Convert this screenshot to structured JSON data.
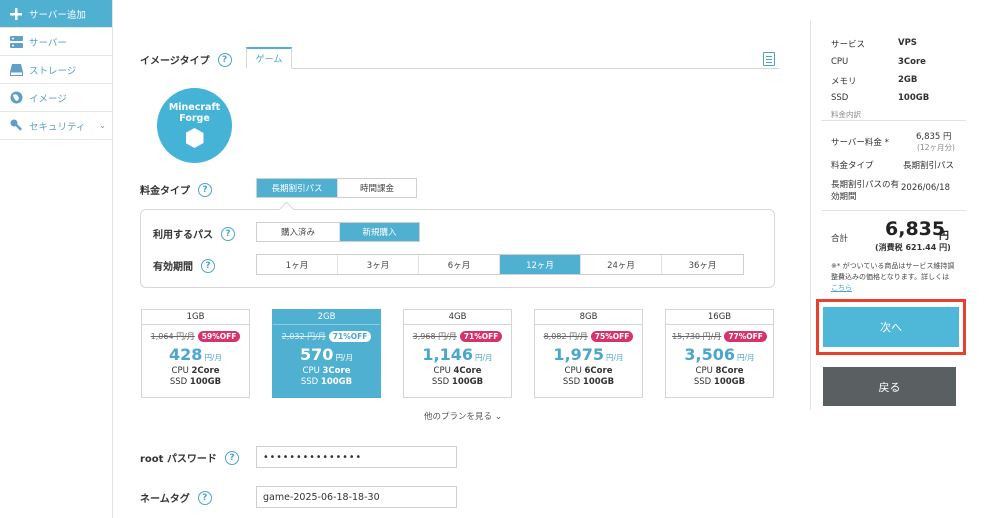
{
  "sidebar": {
    "items": [
      {
        "label": "サーバー追加",
        "icon": "plus-icon"
      },
      {
        "label": "サーバー",
        "icon": "server-icon"
      },
      {
        "label": "ストレージ",
        "icon": "storage-icon"
      },
      {
        "label": "イメージ",
        "icon": "image-icon"
      },
      {
        "label": "セキュリティ",
        "icon": "key-icon"
      }
    ]
  },
  "image_type": {
    "label": "イメージタイプ",
    "tab": "ゲーム",
    "logo_line1": "Minecraft",
    "logo_line2": "Forge"
  },
  "pricing": {
    "label": "料金タイプ",
    "options": [
      "長期割引パス",
      "時間課金"
    ],
    "selected": "長期割引パス",
    "pass_label": "利用するパス",
    "pass_options": [
      "購入済み",
      "新規購入"
    ],
    "pass_selected": "新規購入",
    "period_label": "有効期間",
    "periods": [
      "1ヶ月",
      "3ヶ月",
      "6ヶ月",
      "12ヶ月",
      "24ヶ月",
      "36ヶ月"
    ],
    "period_selected": "12ヶ月"
  },
  "plans": [
    {
      "memory": "1GB",
      "orig": "1,064 円/月",
      "discount": "59%OFF",
      "price": "428",
      "unit": "円/月",
      "cpu_label": "CPU",
      "cpu": "2Core",
      "ssd_label": "SSD",
      "ssd": "100GB"
    },
    {
      "memory": "2GB",
      "orig": "2,032 円/月",
      "discount": "71%OFF",
      "price": "570",
      "unit": "円/月",
      "cpu_label": "CPU",
      "cpu": "3Core",
      "ssd_label": "SSD",
      "ssd": "100GB"
    },
    {
      "memory": "4GB",
      "orig": "3,968 円/月",
      "discount": "71%OFF",
      "price": "1,146",
      "unit": "円/月",
      "cpu_label": "CPU",
      "cpu": "4Core",
      "ssd_label": "SSD",
      "ssd": "100GB"
    },
    {
      "memory": "8GB",
      "orig": "8,082 円/月",
      "discount": "75%OFF",
      "price": "1,975",
      "unit": "円/月",
      "cpu_label": "CPU",
      "cpu": "6Core",
      "ssd_label": "SSD",
      "ssd": "100GB"
    },
    {
      "memory": "16GB",
      "orig": "15,730 円/月",
      "discount": "77%OFF",
      "price": "3,506",
      "unit": "円/月",
      "cpu_label": "CPU",
      "cpu": "8Core",
      "ssd_label": "SSD",
      "ssd": "100GB"
    }
  ],
  "selected_plan": "2GB",
  "more_plans": "他のプランを見る",
  "root_password": {
    "label": "root パスワード",
    "value": "•••••••••••••••"
  },
  "name_tag": {
    "label": "ネームタグ",
    "value": "game-2025-06-18-18-30"
  },
  "summary": {
    "service_label": "サービス",
    "service": "VPS",
    "cpu_label": "CPU",
    "cpu": "3Core",
    "memory_label": "メモリ",
    "memory": "2GB",
    "ssd_label": "SSD",
    "ssd": "100GB",
    "breakdown_label": "料金内訳",
    "server_fee_label": "サーバー料金 *",
    "server_fee": "6,835 円",
    "server_fee_note": "(12ヶ月分)",
    "fee_type_label": "料金タイプ",
    "fee_type": "長期割引パス",
    "expiry_label_1": "長期割引パスの有",
    "expiry_label_2": "効期間",
    "expiry": "2026/06/18",
    "total_label": "合計",
    "total": "6,835",
    "total_unit": "円",
    "tax_note": "(消費税 621.44 円)",
    "footnote_1": "※* がついている商品はサービス維持調",
    "footnote_2": "整費込みの価格となります。詳しくは",
    "footnote_link": "こちら"
  },
  "buttons": {
    "next": "次へ",
    "back": "戻る"
  },
  "colors": {
    "accent": "#4fb0d2",
    "highlight": "#e8402a",
    "badge": "#d6336c",
    "back": "#5a5f62"
  }
}
